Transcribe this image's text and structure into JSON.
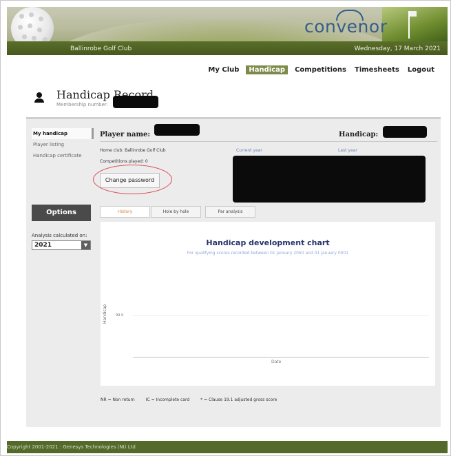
{
  "header": {
    "brand": "convenor",
    "club": "Ballinrobe Golf Club",
    "date": "Wednesday, 17 March 2021"
  },
  "topnav": [
    {
      "label": "My Club"
    },
    {
      "label": "Handicap",
      "active": true
    },
    {
      "label": "Competitions"
    },
    {
      "label": "Timesheets"
    },
    {
      "label": "Logout"
    }
  ],
  "title": {
    "text": "Handicap Record",
    "membership_label": "Membership number:"
  },
  "sidebar": {
    "items": [
      {
        "label": "My handicap",
        "selected": true
      },
      {
        "label": "Player listing"
      },
      {
        "label": "Handicap certificate"
      }
    ],
    "options_label": "Options",
    "analysis_label": "Analysis calculated on:",
    "year": "2021"
  },
  "player": {
    "name_label": "Player name:",
    "handicap_label": "Handicap:",
    "home_club": "Home club: Ballinrobe Golf Club",
    "current_year": "Current year",
    "last_year": "Last year",
    "competitions": "Competitions played: 0",
    "change_password": "Change password"
  },
  "tabs": [
    {
      "label": "History",
      "active": true
    },
    {
      "label": "Hole by hole"
    },
    {
      "label": "Par analysis"
    }
  ],
  "chart_data": {
    "type": "line",
    "title": "Handicap development chart",
    "subtitle": "For qualifying scores recorded between 01 January 2050 and 01 January 0001",
    "xlabel": "Date",
    "ylabel": "Handicap",
    "y_ticks": [
      "99.9"
    ],
    "series": []
  },
  "legend": {
    "nr": "NR = Non return",
    "ic": "IC = Incomplete card",
    "clause": "* = Clause 19.1 adjusted gross score"
  },
  "footer": "Copyright 2001-2021 : Genesys Technologies (NI) Ltd",
  "colors": {
    "header_bar": "#46581e",
    "nav_active": "#7e8a4a",
    "chart_title": "#27326b",
    "highlight_circle": "#d94b57",
    "footer": "#546a2a"
  }
}
